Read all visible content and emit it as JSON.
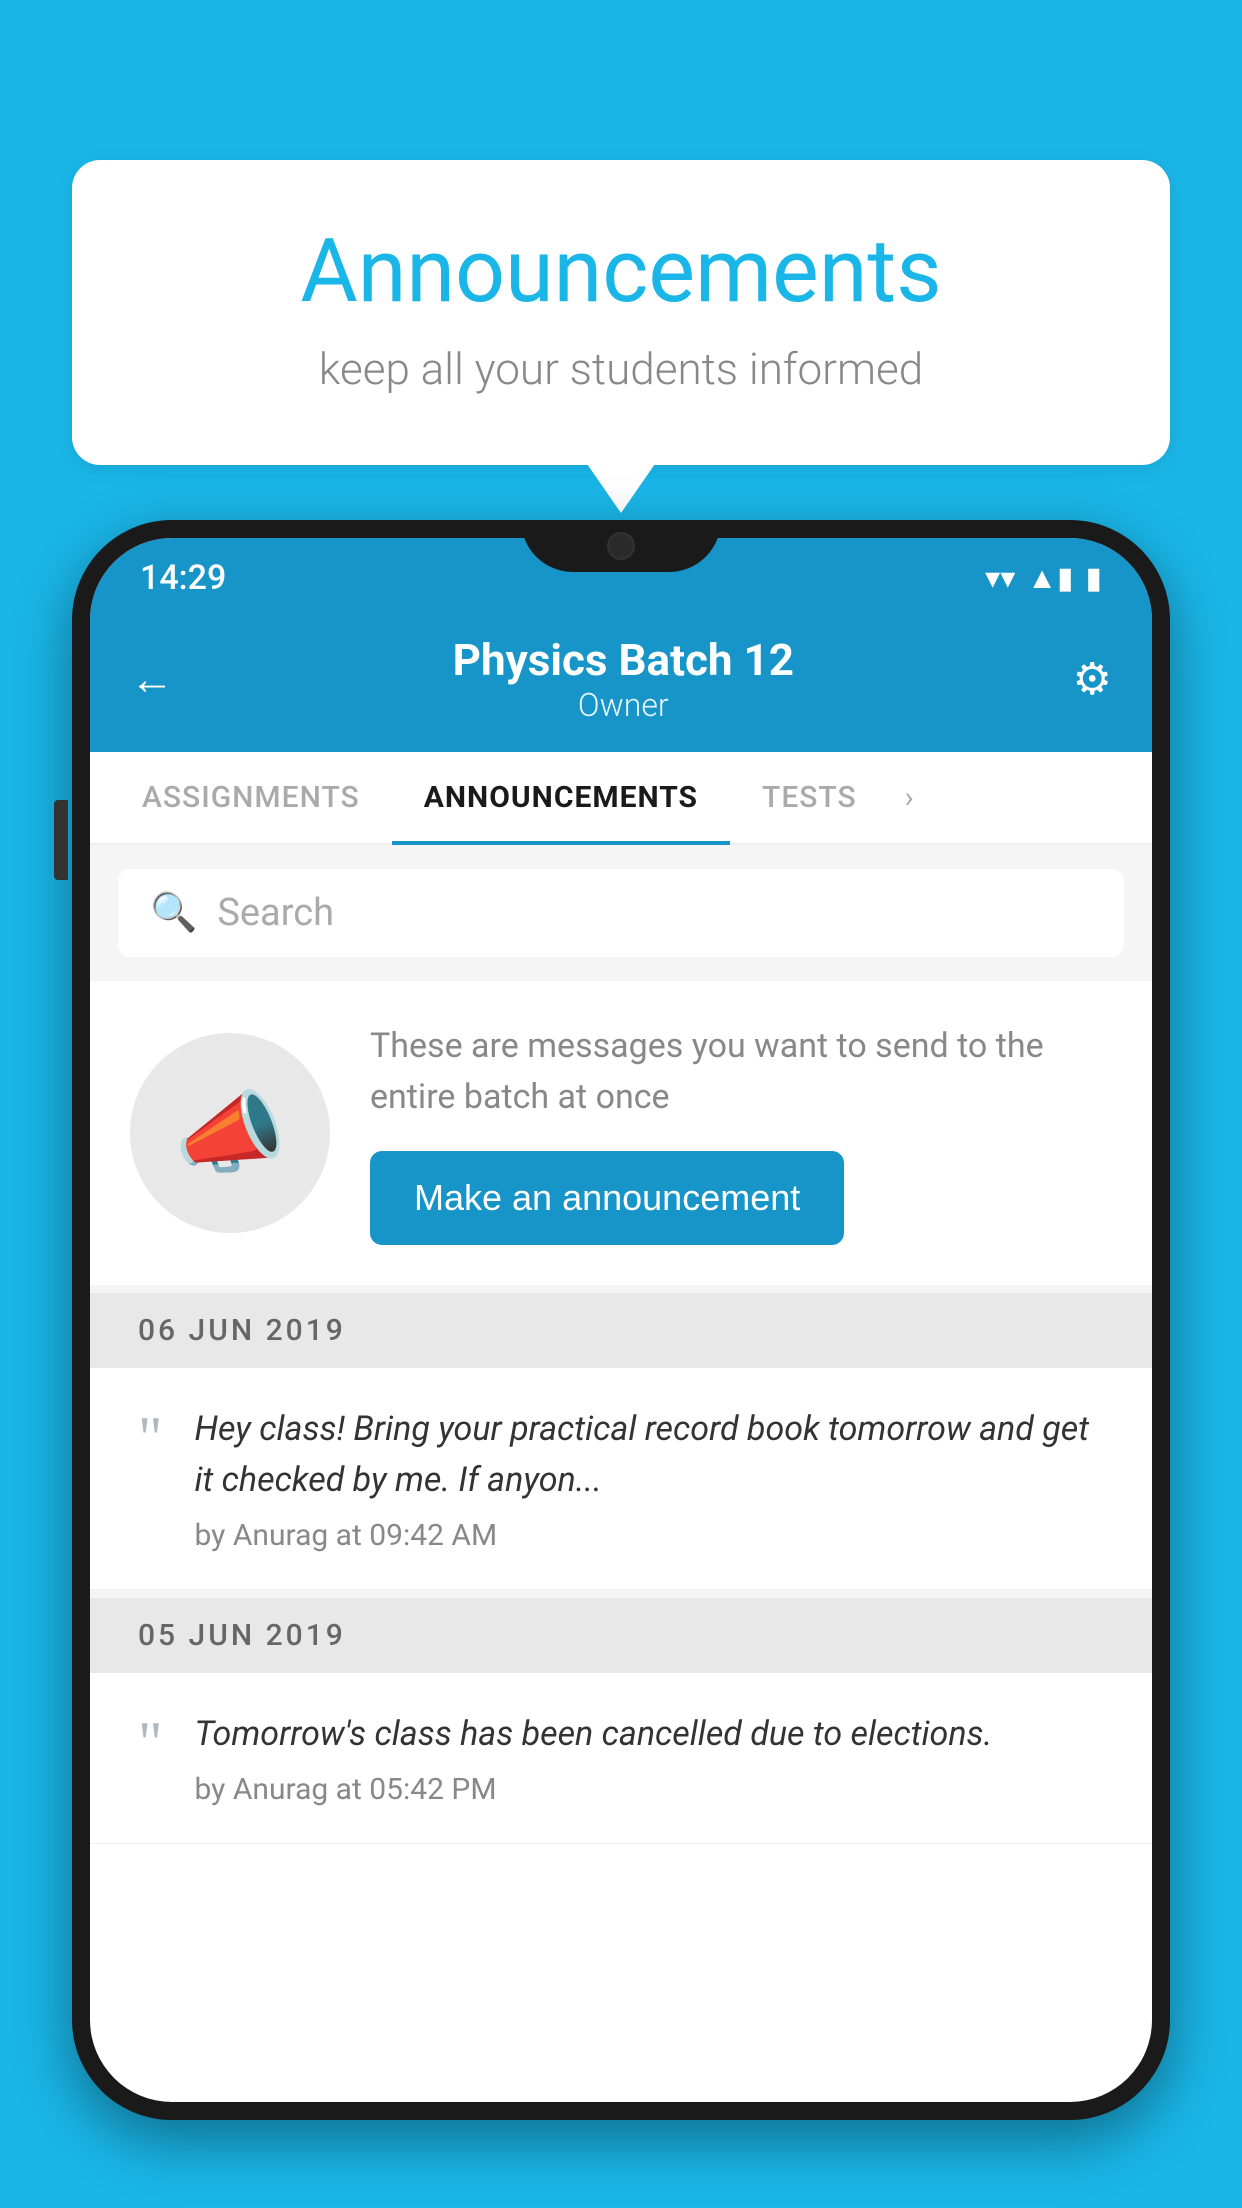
{
  "background_color": "#1ab6e8",
  "speech_bubble": {
    "title": "Announcements",
    "subtitle": "keep all your students informed"
  },
  "phone": {
    "status_bar": {
      "time": "14:29",
      "wifi": "▼",
      "signal": "▲",
      "battery": "▮"
    },
    "header": {
      "back_label": "←",
      "title": "Physics Batch 12",
      "subtitle": "Owner",
      "gear_label": "⚙"
    },
    "tabs": [
      {
        "label": "ASSIGNMENTS",
        "active": false
      },
      {
        "label": "ANNOUNCEMENTS",
        "active": true
      },
      {
        "label": "TESTS",
        "active": false
      }
    ],
    "search": {
      "placeholder": "Search"
    },
    "announcement_prompt": {
      "description": "These are messages you want to send to the entire batch at once",
      "button_label": "Make an announcement"
    },
    "announcements": [
      {
        "date": "06  JUN  2019",
        "text": "Hey class! Bring your practical record book tomorrow and get it checked by me. If anyon...",
        "meta": "by Anurag at 09:42 AM"
      },
      {
        "date": "05  JUN  2019",
        "text": "Tomorrow's class has been cancelled due to elections.",
        "meta": "by Anurag at 05:42 PM"
      }
    ]
  }
}
